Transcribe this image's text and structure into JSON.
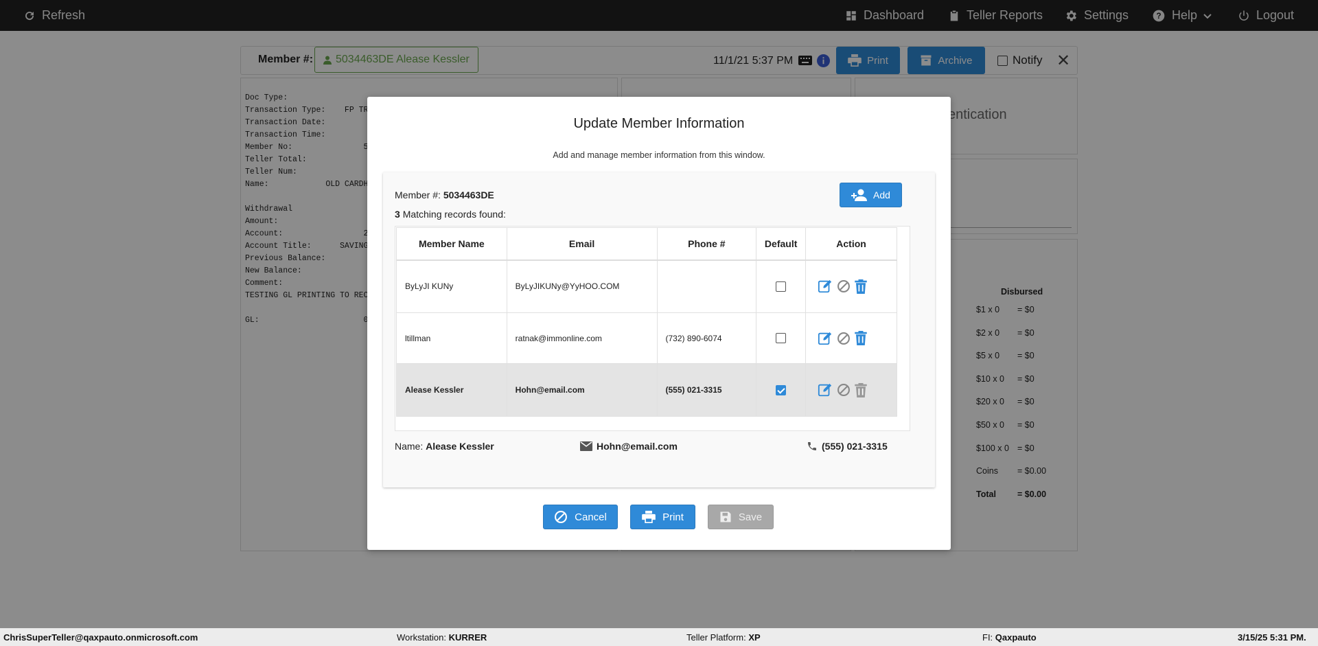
{
  "topbar": {
    "refresh": "Refresh",
    "dashboard": "Dashboard",
    "teller_reports": "Teller Reports",
    "settings": "Settings",
    "help": "Help",
    "logout": "Logout"
  },
  "background": {
    "member_label": "Member #:",
    "member_pill": "5034463DE Alease Kessler",
    "datetime": "11/1/21 5:37 PM",
    "print": "Print",
    "archive": "Archive",
    "notify": "Notify",
    "close": "✕",
    "receipt_lines": [
      "Doc Type:",
      "Transaction Type:    FP TRA",
      "Transaction Date:",
      "Transaction Time:",
      "Member No:               5",
      "Teller Total:",
      "Teller Num:",
      "Name:            OLD CARDH",
      "",
      "Withdrawal",
      "Amount:",
      "Account:                 2",
      "Account Title:      SAVINGS",
      "Previous Balance:",
      "New Balance:",
      "Comment:",
      "TESTING GL PRINTING TO RECE",
      "",
      "GL:                      0"
    ],
    "auth_text": "entication",
    "disbursed_header": "Disbursed",
    "disbursed": [
      {
        "k": "$1 x 0",
        "v": "= $0"
      },
      {
        "k": "$2 x 0",
        "v": "= $0"
      },
      {
        "k": "$5 x 0",
        "v": "= $0"
      },
      {
        "k": "$10 x 0",
        "v": "= $0"
      },
      {
        "k": "$20 x 0",
        "v": "= $0"
      },
      {
        "k": "$50 x 0",
        "v": "= $0"
      },
      {
        "k": "$100 x 0",
        "v": "= $0"
      },
      {
        "k": "Coins",
        "v": "= $0.00"
      },
      {
        "k": "Total",
        "v": "= $0.00"
      }
    ]
  },
  "modal": {
    "title": "Update Member Information",
    "subtitle": "Add and manage member information from this window.",
    "member_label": "Member #:",
    "member_number": "5034463DE",
    "match_count": "3",
    "match_text": "Matching records found:",
    "add_button": "Add",
    "columns": [
      "Member Name",
      "Email",
      "Phone #",
      "Default",
      "Action"
    ],
    "rows": [
      {
        "name": "ByLyJI KUNy",
        "email": "ByLyJIKUNy@YyHOO.COM",
        "phone": "",
        "default": false
      },
      {
        "name": "ltillman",
        "email": "ratnak@immonline.com",
        "phone": "(732) 890-6074",
        "default": false
      },
      {
        "name": "Alease Kessler",
        "email": "Hohn@email.com",
        "phone": "(555) 021-3315",
        "default": true
      }
    ],
    "name_label": "Name:",
    "selected_name": "Alease Kessler",
    "selected_email": "Hohn@email.com",
    "selected_phone": "(555) 021-3315",
    "cancel": "Cancel",
    "print": "Print",
    "save": "Save"
  },
  "statusbar": {
    "user": "ChrisSuperTeller@qaxpauto.onmicrosoft.com",
    "workstation_label": "Workstation:",
    "workstation": "KURRER",
    "platform_label": "Teller Platform:",
    "platform": "XP",
    "fi_label": "FI:",
    "fi": "Qaxpauto",
    "datetime": "3/15/25 5:31 PM."
  },
  "colors": {
    "primary": "#2f8ad8",
    "topbar": "#222222",
    "member_green": "#6aa84f",
    "disabled": "#a8a8a8"
  }
}
